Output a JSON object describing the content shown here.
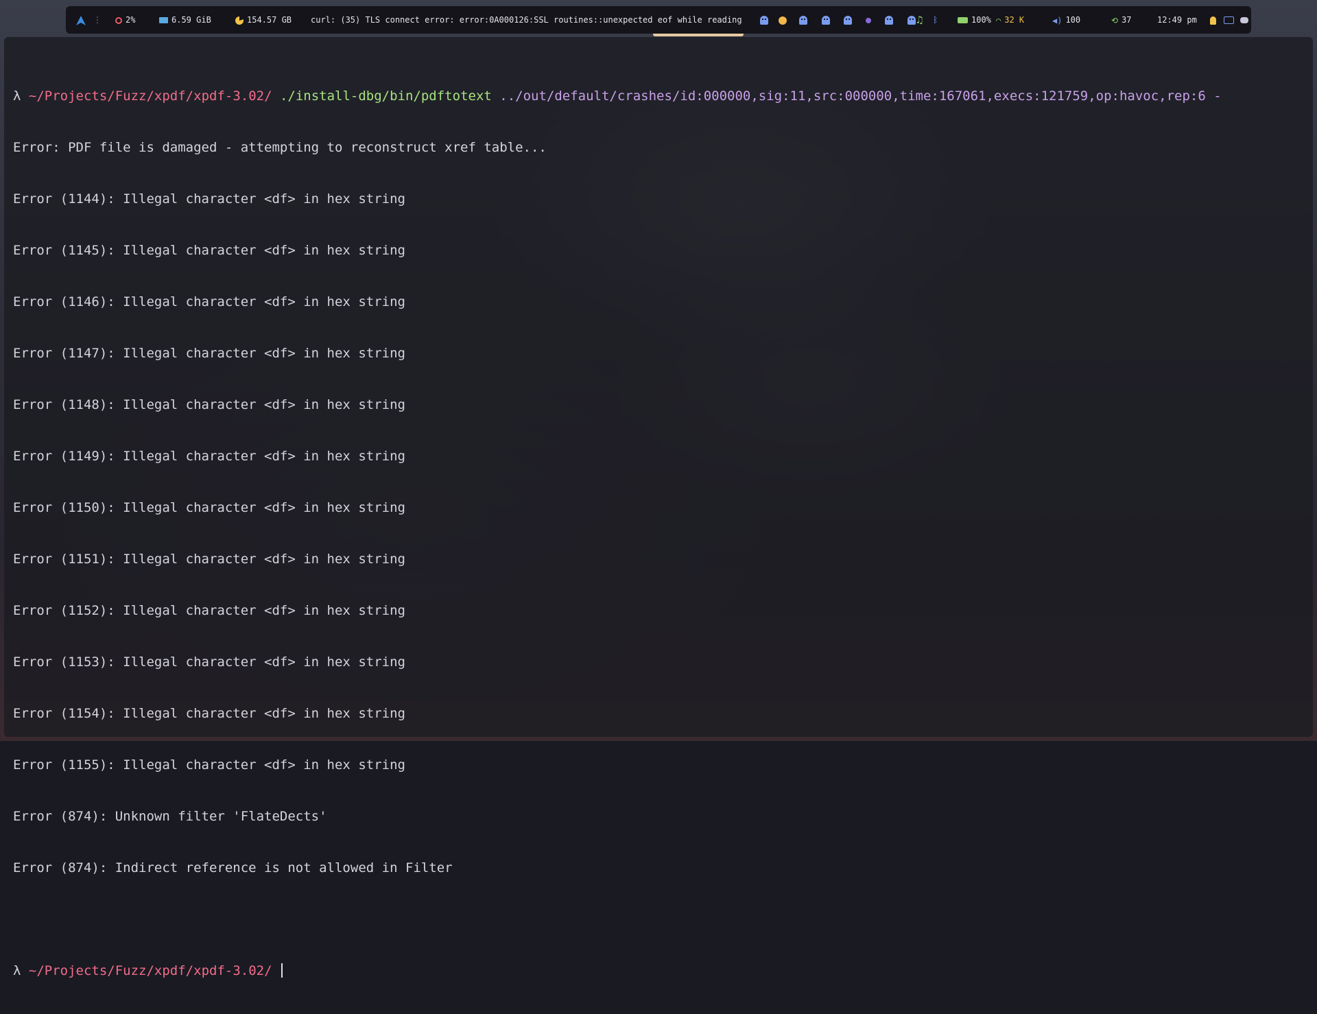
{
  "topbar": {
    "cpu": "2%",
    "memory": "6.59 GiB",
    "disk": "154.57 GB",
    "notification": "curl: (35) TLS connect error: error:0A000126:SSL routines::unexpected eof while reading",
    "battery": "100%",
    "network": "32 K",
    "volume": "100",
    "updates": "37",
    "clock": "12:49 pm"
  },
  "terminal": {
    "prompt_symbol": "λ",
    "command_path": "~/Projects/Fuzz/xpdf/xpdf-3.02/",
    "command": "./install-dbg/bin/pdftotext",
    "command_args": "../out/default/crashes/id:000000,sig:11,src:000000,time:167061,execs:121759,op:havoc,rep:6 -",
    "output": [
      "Error: PDF file is damaged - attempting to reconstruct xref table...",
      "Error (1144): Illegal character <df> in hex string",
      "Error (1145): Illegal character <df> in hex string",
      "Error (1146): Illegal character <df> in hex string",
      "Error (1147): Illegal character <df> in hex string",
      "Error (1148): Illegal character <df> in hex string",
      "Error (1149): Illegal character <df> in hex string",
      "Error (1150): Illegal character <df> in hex string",
      "Error (1151): Illegal character <df> in hex string",
      "Error (1152): Illegal character <df> in hex string",
      "Error (1153): Illegal character <df> in hex string",
      "Error (1154): Illegal character <df> in hex string",
      "Error (1155): Illegal character <df> in hex string",
      "Error (874): Unknown filter 'FlateDects'",
      "Error (874): Indirect reference is not allowed in Filter"
    ],
    "current_path": "~/Projects/Fuzz/xpdf/xpdf-3.02/"
  },
  "colors": {
    "path": "#f26d8a",
    "command": "#a7e27e",
    "args": "#c8a0e8",
    "text": "#d4d4dc",
    "bar_bg": "#14141a"
  }
}
